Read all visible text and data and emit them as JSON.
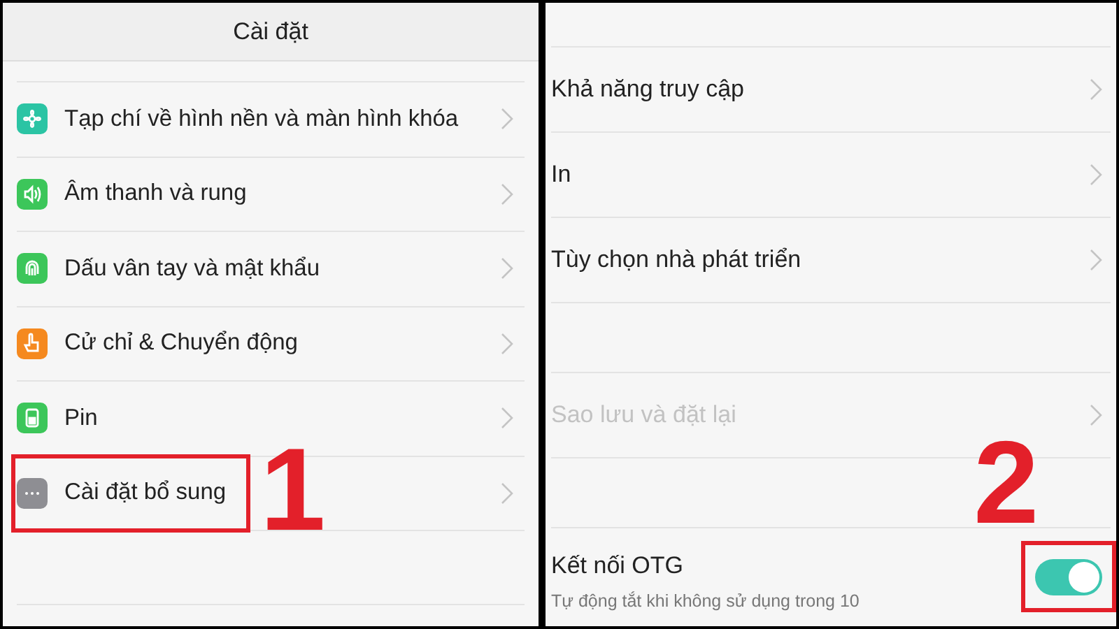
{
  "left_screen": {
    "title": "Cài đặt",
    "items": [
      {
        "label": "Tạp chí về hình nền và màn hình khóa",
        "color": "#2bc4a4"
      },
      {
        "label": "Âm thanh và rung",
        "color": "#3cc65a"
      },
      {
        "label": "Dấu vân tay và mật khẩu",
        "color": "#3cc65a"
      },
      {
        "label": "Cử chỉ & Chuyển động",
        "color": "#f5891f"
      },
      {
        "label": "Pin",
        "color": "#3cc65a"
      },
      {
        "label": "Cài đặt bổ sung",
        "color": "#8e8e93"
      }
    ]
  },
  "right_screen": {
    "items": [
      {
        "kind": "link",
        "label": "Khả năng truy cập",
        "disabled": false
      },
      {
        "kind": "link",
        "label": "In",
        "disabled": false
      },
      {
        "kind": "link",
        "label": "Tùy chọn nhà phát triển",
        "disabled": false
      },
      {
        "kind": "gap"
      },
      {
        "kind": "link",
        "label": "Sao lưu và đặt lại",
        "disabled": true
      },
      {
        "kind": "gap"
      },
      {
        "kind": "toggle",
        "label": "Kết nối OTG",
        "subtitle": "Tự động tắt khi không sử dụng trong 10",
        "on": true
      }
    ]
  },
  "annotations": [
    {
      "step": "1"
    },
    {
      "step": "2"
    }
  ]
}
